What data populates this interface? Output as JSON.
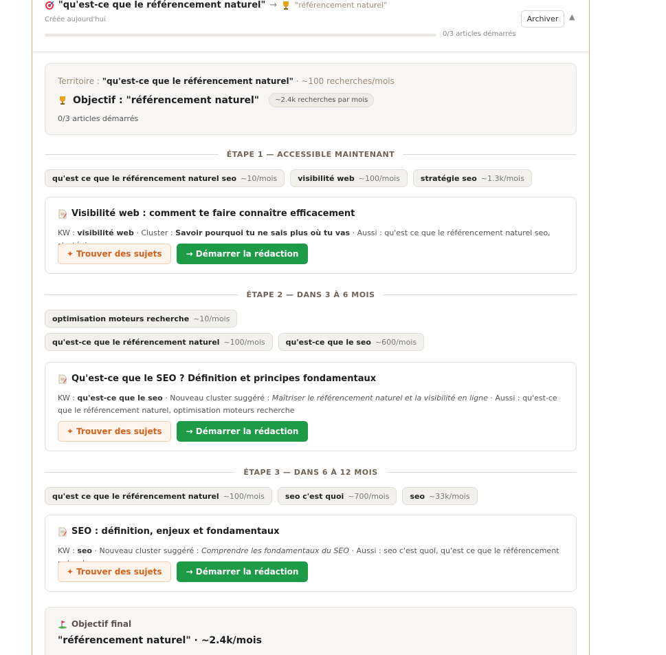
{
  "header": {
    "title": "\"qu'est-ce que le référencement naturel\"",
    "arrow": "→",
    "target": "\"référencement naturel\"",
    "created": "Créée aujourd'hui",
    "progress_label": "0/3 articles démarrés",
    "progress_fraction": 0,
    "archive_label": "Archiver",
    "collapse_glyph": "▲"
  },
  "territory": {
    "label": "Territoire : ",
    "keyword": "\"qu'est-ce que le référencement naturel\"",
    "volume": " · ~100 recherches/mois",
    "objective_label": "Objectif : \"référencement naturel\"",
    "objective_volume": "~2.4k recherches par mois",
    "started": "0/3 articles démarrés"
  },
  "steps": [
    {
      "label": "ÉTAPE 1 — ACCESSIBLE MAINTENANT",
      "chips": [
        {
          "kw": "qu'est ce que le référencement naturel seo",
          "vol": "~10/mois"
        },
        {
          "kw": "visibilité web",
          "vol": "~100/mois"
        },
        {
          "kw": "stratégie seo",
          "vol": "~1.3k/mois"
        }
      ],
      "article": {
        "title": "Visibilité web : comment te faire connaître efficacement",
        "kw_label": "KW : ",
        "kw": "visibilité web",
        "cluster_label": " · Cluster : ",
        "cluster": "Savoir pourquoi tu ne sais plus où tu vas",
        "also_label": " · Aussi : ",
        "also": "qu'est ce que le référencement naturel seo, stratégie seo"
      }
    },
    {
      "label": "ÉTAPE 2 — DANS 3 À 6 MOIS",
      "chips": [
        {
          "kw": "optimisation moteurs recherche",
          "vol": "~10/mois"
        },
        {
          "kw": "qu'est-ce que le référencement naturel",
          "vol": "~100/mois"
        },
        {
          "kw": "qu'est-ce que le seo",
          "vol": "~600/mois"
        }
      ],
      "article": {
        "title": "Qu'est-ce que le SEO ? Définition et principes fondamentaux",
        "kw_label": "KW : ",
        "kw": "qu'est-ce que le seo",
        "cluster_label": " · Nouveau cluster suggéré : ",
        "cluster": "Maîtriser le référencement naturel et la visibilité en ligne",
        "also_label": " · Aussi : ",
        "also": "qu'est-ce que le référencement naturel, optimisation moteurs recherche"
      }
    },
    {
      "label": "ÉTAPE 3 — DANS 6 À 12 MOIS",
      "chips": [
        {
          "kw": "qu'est ce que le référencement naturel",
          "vol": "~100/mois"
        },
        {
          "kw": "seo c'est quoi",
          "vol": "~700/mois"
        },
        {
          "kw": "seo",
          "vol": "~33k/mois"
        }
      ],
      "article": {
        "title": "SEO : définition, enjeux et fondamentaux",
        "kw_label": "KW : ",
        "kw": "seo",
        "cluster_label": " · Nouveau cluster suggéré : ",
        "cluster": "Comprendre les fondamentaux du SEO",
        "also_label": " · Aussi : ",
        "also": "seo c'est quoi, qu'est ce que le référencement naturel"
      }
    }
  ],
  "buttons": {
    "topics_label": "Trouver des sujets",
    "topics_glyph": "✦",
    "start_label": "→ Démarrer la rédaction"
  },
  "final": {
    "label": "Objectif final",
    "value": "\"référencement naturel\" · ~2.4k/mois"
  },
  "colors": {
    "accent_orange": "#d5621f",
    "start_green": "#1e9b46",
    "border_tan": "#d9a679"
  },
  "icons": {
    "header_icon": "target-icon",
    "objective_icon": "trophy-icon",
    "article_icon": "document-icon",
    "final_icon": "golf-flag-icon"
  }
}
